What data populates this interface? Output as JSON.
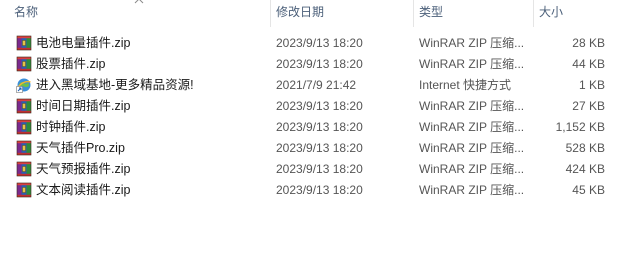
{
  "columns": {
    "name": "名称",
    "date": "修改日期",
    "type": "类型",
    "size": "大小"
  },
  "files": [
    {
      "name": "电池电量插件.zip",
      "date": "2023/9/13 18:20",
      "type": "WinRAR ZIP 压缩...",
      "size": "28 KB",
      "icon": "winrar-zip-icon"
    },
    {
      "name": "股票插件.zip",
      "date": "2023/9/13 18:20",
      "type": "WinRAR ZIP 压缩...",
      "size": "44 KB",
      "icon": "winrar-zip-icon"
    },
    {
      "name": "进入黑域基地-更多精品资源!",
      "date": "2021/7/9 21:42",
      "type": "Internet 快捷方式",
      "size": "1 KB",
      "icon": "internet-shortcut-icon"
    },
    {
      "name": "时间日期插件.zip",
      "date": "2023/9/13 18:20",
      "type": "WinRAR ZIP 压缩...",
      "size": "27 KB",
      "icon": "winrar-zip-icon"
    },
    {
      "name": "时钟插件.zip",
      "date": "2023/9/13 18:20",
      "type": "WinRAR ZIP 压缩...",
      "size": "1,152 KB",
      "icon": "winrar-zip-icon"
    },
    {
      "name": "天气插件Pro.zip",
      "date": "2023/9/13 18:20",
      "type": "WinRAR ZIP 压缩...",
      "size": "528 KB",
      "icon": "winrar-zip-icon"
    },
    {
      "name": "天气预报插件.zip",
      "date": "2023/9/13 18:20",
      "type": "WinRAR ZIP 压缩...",
      "size": "424 KB",
      "icon": "winrar-zip-icon"
    },
    {
      "name": "文本阅读插件.zip",
      "date": "2023/9/13 18:20",
      "type": "WinRAR ZIP 压缩...",
      "size": "45 KB",
      "icon": "winrar-zip-icon"
    }
  ]
}
